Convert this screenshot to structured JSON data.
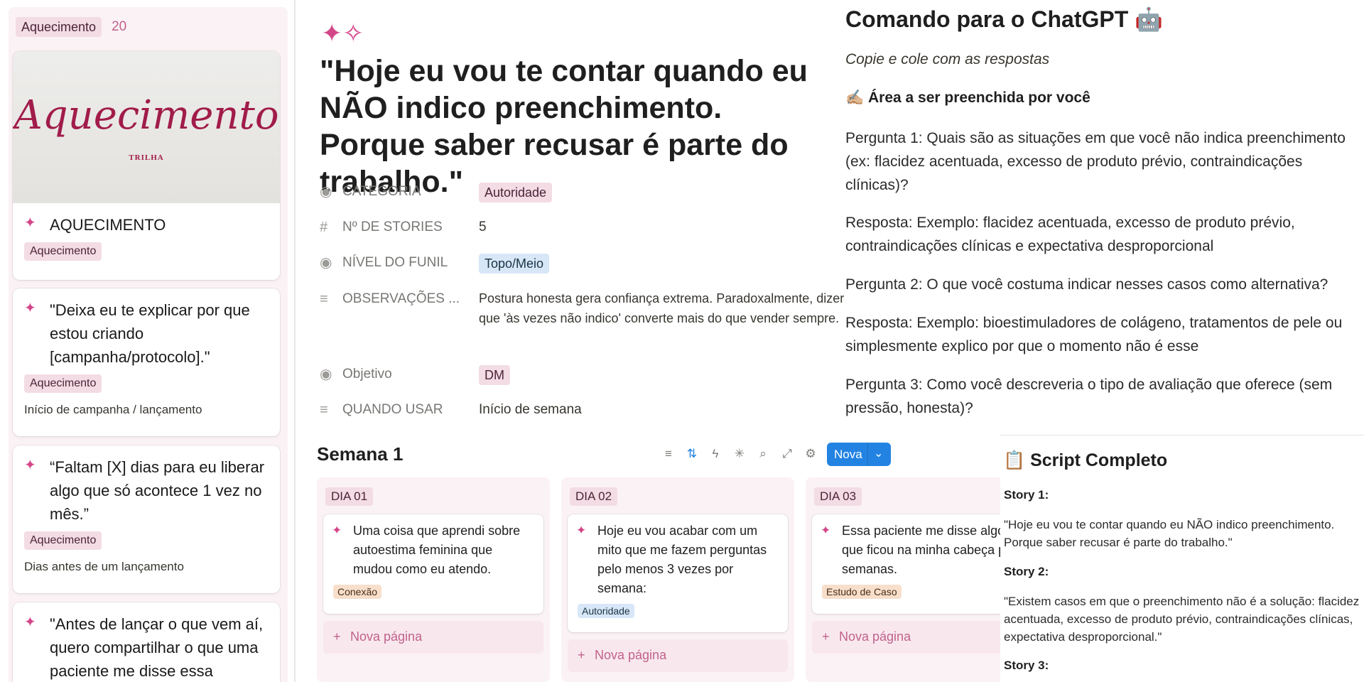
{
  "left_group": {
    "name": "Aquecimento",
    "count": "20",
    "cards": [
      {
        "cover_title": "Aquecimento",
        "cover_subtitle": "TRILHA",
        "title": "AQUECIMENTO",
        "tag": "Aquecimento",
        "note": ""
      },
      {
        "title": "\"Deixa eu te explicar por que estou criando [campanha/protocolo].\"",
        "tag": "Aquecimento",
        "note": "Início de campanha / lançamento"
      },
      {
        "title": "“Faltam [X] dias para eu liberar algo que só acontece 1 vez no mês.”",
        "tag": "Aquecimento",
        "note": "Dias antes de um lançamento"
      },
      {
        "title": "\"Antes de lançar o que vem aí, quero compartilhar o que uma paciente me disse essa",
        "tag": "",
        "note": ""
      }
    ]
  },
  "page": {
    "title": "\"Hoje eu vou te contar quando eu NÃO indico preenchimento. Porque saber recusar é parte do trabalho.\"",
    "properties": [
      {
        "label": "CATEGORIA",
        "value": "Autoridade",
        "kind": "tag-pink"
      },
      {
        "label": "Nº DE STORIES",
        "value": "5",
        "kind": "text"
      },
      {
        "label": "NÍVEL DO FUNIL",
        "value": "Topo/Meio",
        "kind": "tag-blue"
      },
      {
        "label": "OBSERVAÇÕES ...",
        "value": "Postura honesta gera confiança extrema. Paradoxalmente, dizer que 'às vezes não indico' converte mais do que vender sempre.",
        "kind": "text"
      },
      {
        "label": "Objetivo",
        "value": "DM",
        "kind": "tag-pink"
      },
      {
        "label": "QUANDO USAR",
        "value": "Início de semana",
        "kind": "text"
      }
    ]
  },
  "board": {
    "title": "Semana 1",
    "new_button": "Nova",
    "columns": [
      {
        "label": "DIA 01",
        "card_text": "Uma coisa que aprendi sobre autoestima feminina que mudou como eu atendo.",
        "card_tag": "Conexão",
        "new_page": "Nova página"
      },
      {
        "label": "DIA 02",
        "card_text": "Hoje eu vou acabar com um mito que me fazem perguntas pelo menos 3 vezes por semana:",
        "card_tag": "Autoridade",
        "new_page": "Nova página"
      },
      {
        "label": "DIA 03",
        "card_text": "Essa paciente me disse algo que ficou na minha cabeça por semanas.",
        "card_tag": "Estudo de Caso",
        "new_page": "Nova página"
      }
    ]
  },
  "right": {
    "title": "Comando para o ChatGPT 🤖",
    "subtitle": "Copie e cole com as respostas",
    "area_title": "✍🏼 Área a ser preenchida por você",
    "qa": [
      "Pergunta 1: Quais são as situações em que você não indica preenchimento (ex: flacidez acentuada, excesso de produto prévio, contraindicações clínicas)?",
      "Resposta: Exemplo: flacidez acentuada, excesso de produto prévio, contraindicações clínicas e expectativa desproporcional",
      "Pergunta 2: O que você costuma indicar nesses casos como alternativa?",
      "Resposta: Exemplo: bioestimuladores de colágeno, tratamentos de pele ou simplesmente explico por que o momento não é esse",
      "Pergunta 3: Como você descreveria o tipo de avaliação que oferece (sem pressão, honesta)?"
    ]
  },
  "script": {
    "title": "📋 Script Completo",
    "story1_label": "Story 1:",
    "story1_text": "\"Hoje eu vou te contar quando eu NÃO indico preenchimento. Porque saber recusar é parte do trabalho.\"",
    "story2_label": "Story 2:",
    "story2_text": "\"Existem casos em que o preenchimento não é a solução: flacidez acentuada, excesso de produto prévio, contraindicações clínicas, expectativa desproporcional.\"",
    "story3_label": "Story 3:"
  }
}
